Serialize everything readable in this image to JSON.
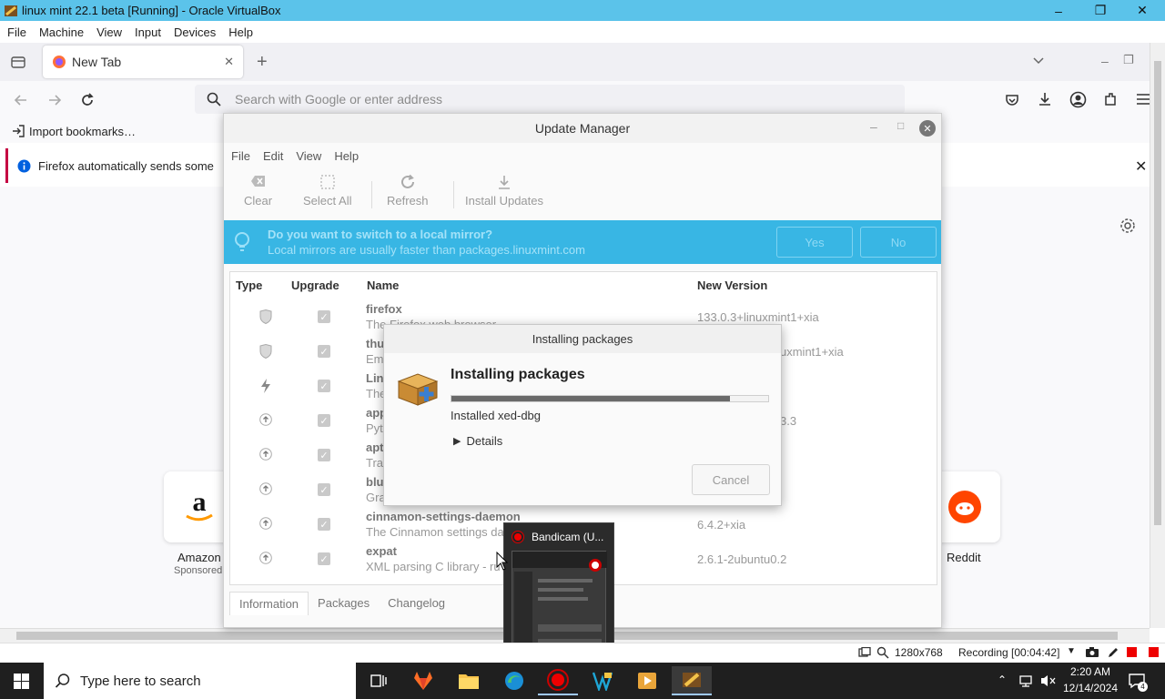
{
  "vbox": {
    "title": "linux mint 22.1 beta [Running] - Oracle VirtualBox",
    "menu": [
      "File",
      "Machine",
      "View",
      "Input",
      "Devices",
      "Help"
    ]
  },
  "firefox": {
    "tab_title": "New Tab",
    "url_placeholder": "Search with Google or enter address",
    "import_bookmarks": "Import bookmarks…",
    "notice": "Firefox automatically sends some",
    "shortcuts": [
      {
        "name": "Amazon",
        "sub": "Sponsored"
      },
      {
        "name": "Reddit",
        "sub": ""
      }
    ]
  },
  "update_manager": {
    "title": "Update Manager",
    "menu": [
      "File",
      "Edit",
      "View",
      "Help"
    ],
    "toolbar": {
      "clear": "Clear",
      "select_all": "Select All",
      "refresh": "Refresh",
      "install": "Install Updates"
    },
    "banner": {
      "title": "Do you want to switch to a local mirror?",
      "subtitle": "Local mirrors are usually faster than packages.linuxmint.com",
      "yes": "Yes",
      "no": "No"
    },
    "columns": {
      "type": "Type",
      "upgrade": "Upgrade",
      "name": "Name",
      "version": "New Version"
    },
    "rows": [
      {
        "type": "security",
        "name": "firefox",
        "desc": "The Firefox web browser",
        "version": "133.0.3+linuxmint1+xia"
      },
      {
        "type": "security",
        "name": "thu",
        "desc": "Em",
        "version": "uxmint1+xia"
      },
      {
        "type": "kernel",
        "name": "Lin",
        "desc": "The",
        "version": ""
      },
      {
        "type": "update",
        "name": "app",
        "desc": "Pyt",
        "version": "3.3"
      },
      {
        "type": "update",
        "name": "apt",
        "desc": "Tra",
        "version": ""
      },
      {
        "type": "update",
        "name": "blu",
        "desc": "Gra",
        "version": ""
      },
      {
        "type": "update",
        "name": "cinnamon-settings-daemon",
        "desc": "The Cinnamon settings da",
        "version": "6.4.2+xia"
      },
      {
        "type": "update",
        "name": "expat",
        "desc": "XML parsing C library - ru",
        "version": "2.6.1-2ubuntu0.2"
      }
    ],
    "tabs": [
      "Information",
      "Packages",
      "Changelog"
    ]
  },
  "install_dialog": {
    "title": "Installing packages",
    "heading": "Installing packages",
    "progress": 0.88,
    "status": "Installed xed-dbg",
    "details": "Details",
    "cancel": "Cancel"
  },
  "status_bar": {
    "resolution": "1280x768",
    "recording": "Recording [00:04:42]"
  },
  "bandicam": {
    "title": "Bandicam (U..."
  },
  "taskbar": {
    "search_placeholder": "Type here to search",
    "time": "2:20 AM",
    "date": "12/14/2024",
    "notification_count": "4"
  }
}
